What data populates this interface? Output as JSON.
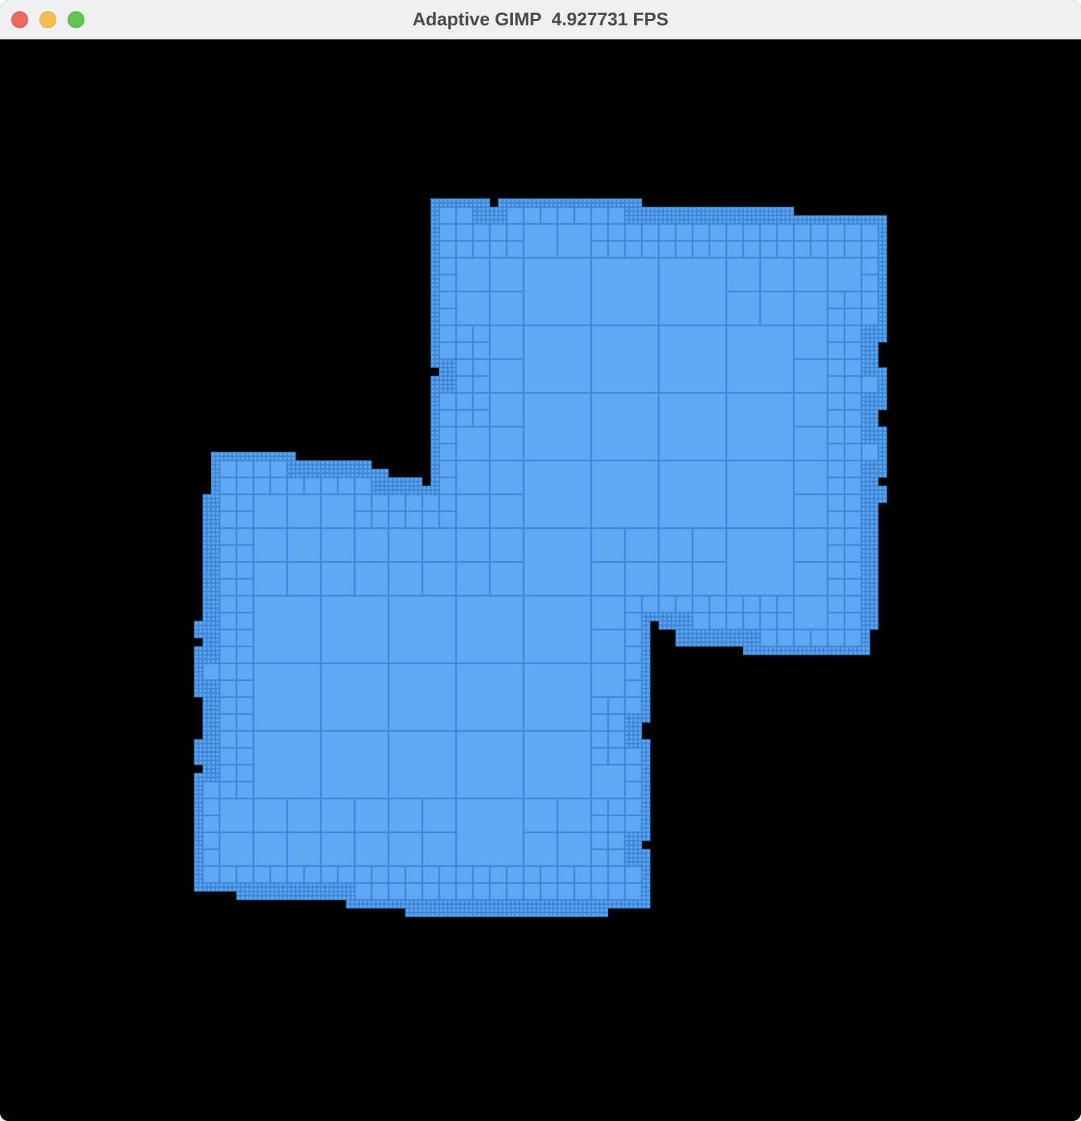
{
  "window": {
    "title": "Adaptive GIMP  4.927731 FPS",
    "controls": {
      "close": {
        "icon": "close-dot-icon",
        "color": "#ec6a5e"
      },
      "minimize": {
        "icon": "minimize-dot-icon",
        "color": "#f4bf4f"
      },
      "maximize": {
        "icon": "maximize-dot-icon",
        "color": "#61c554"
      }
    }
  },
  "canvas": {
    "background": "#000000",
    "mesh_fill": "#5ea9f1",
    "mesh_line": "#3f88d4",
    "description_kind": "adaptive quadtree mesh"
  }
}
